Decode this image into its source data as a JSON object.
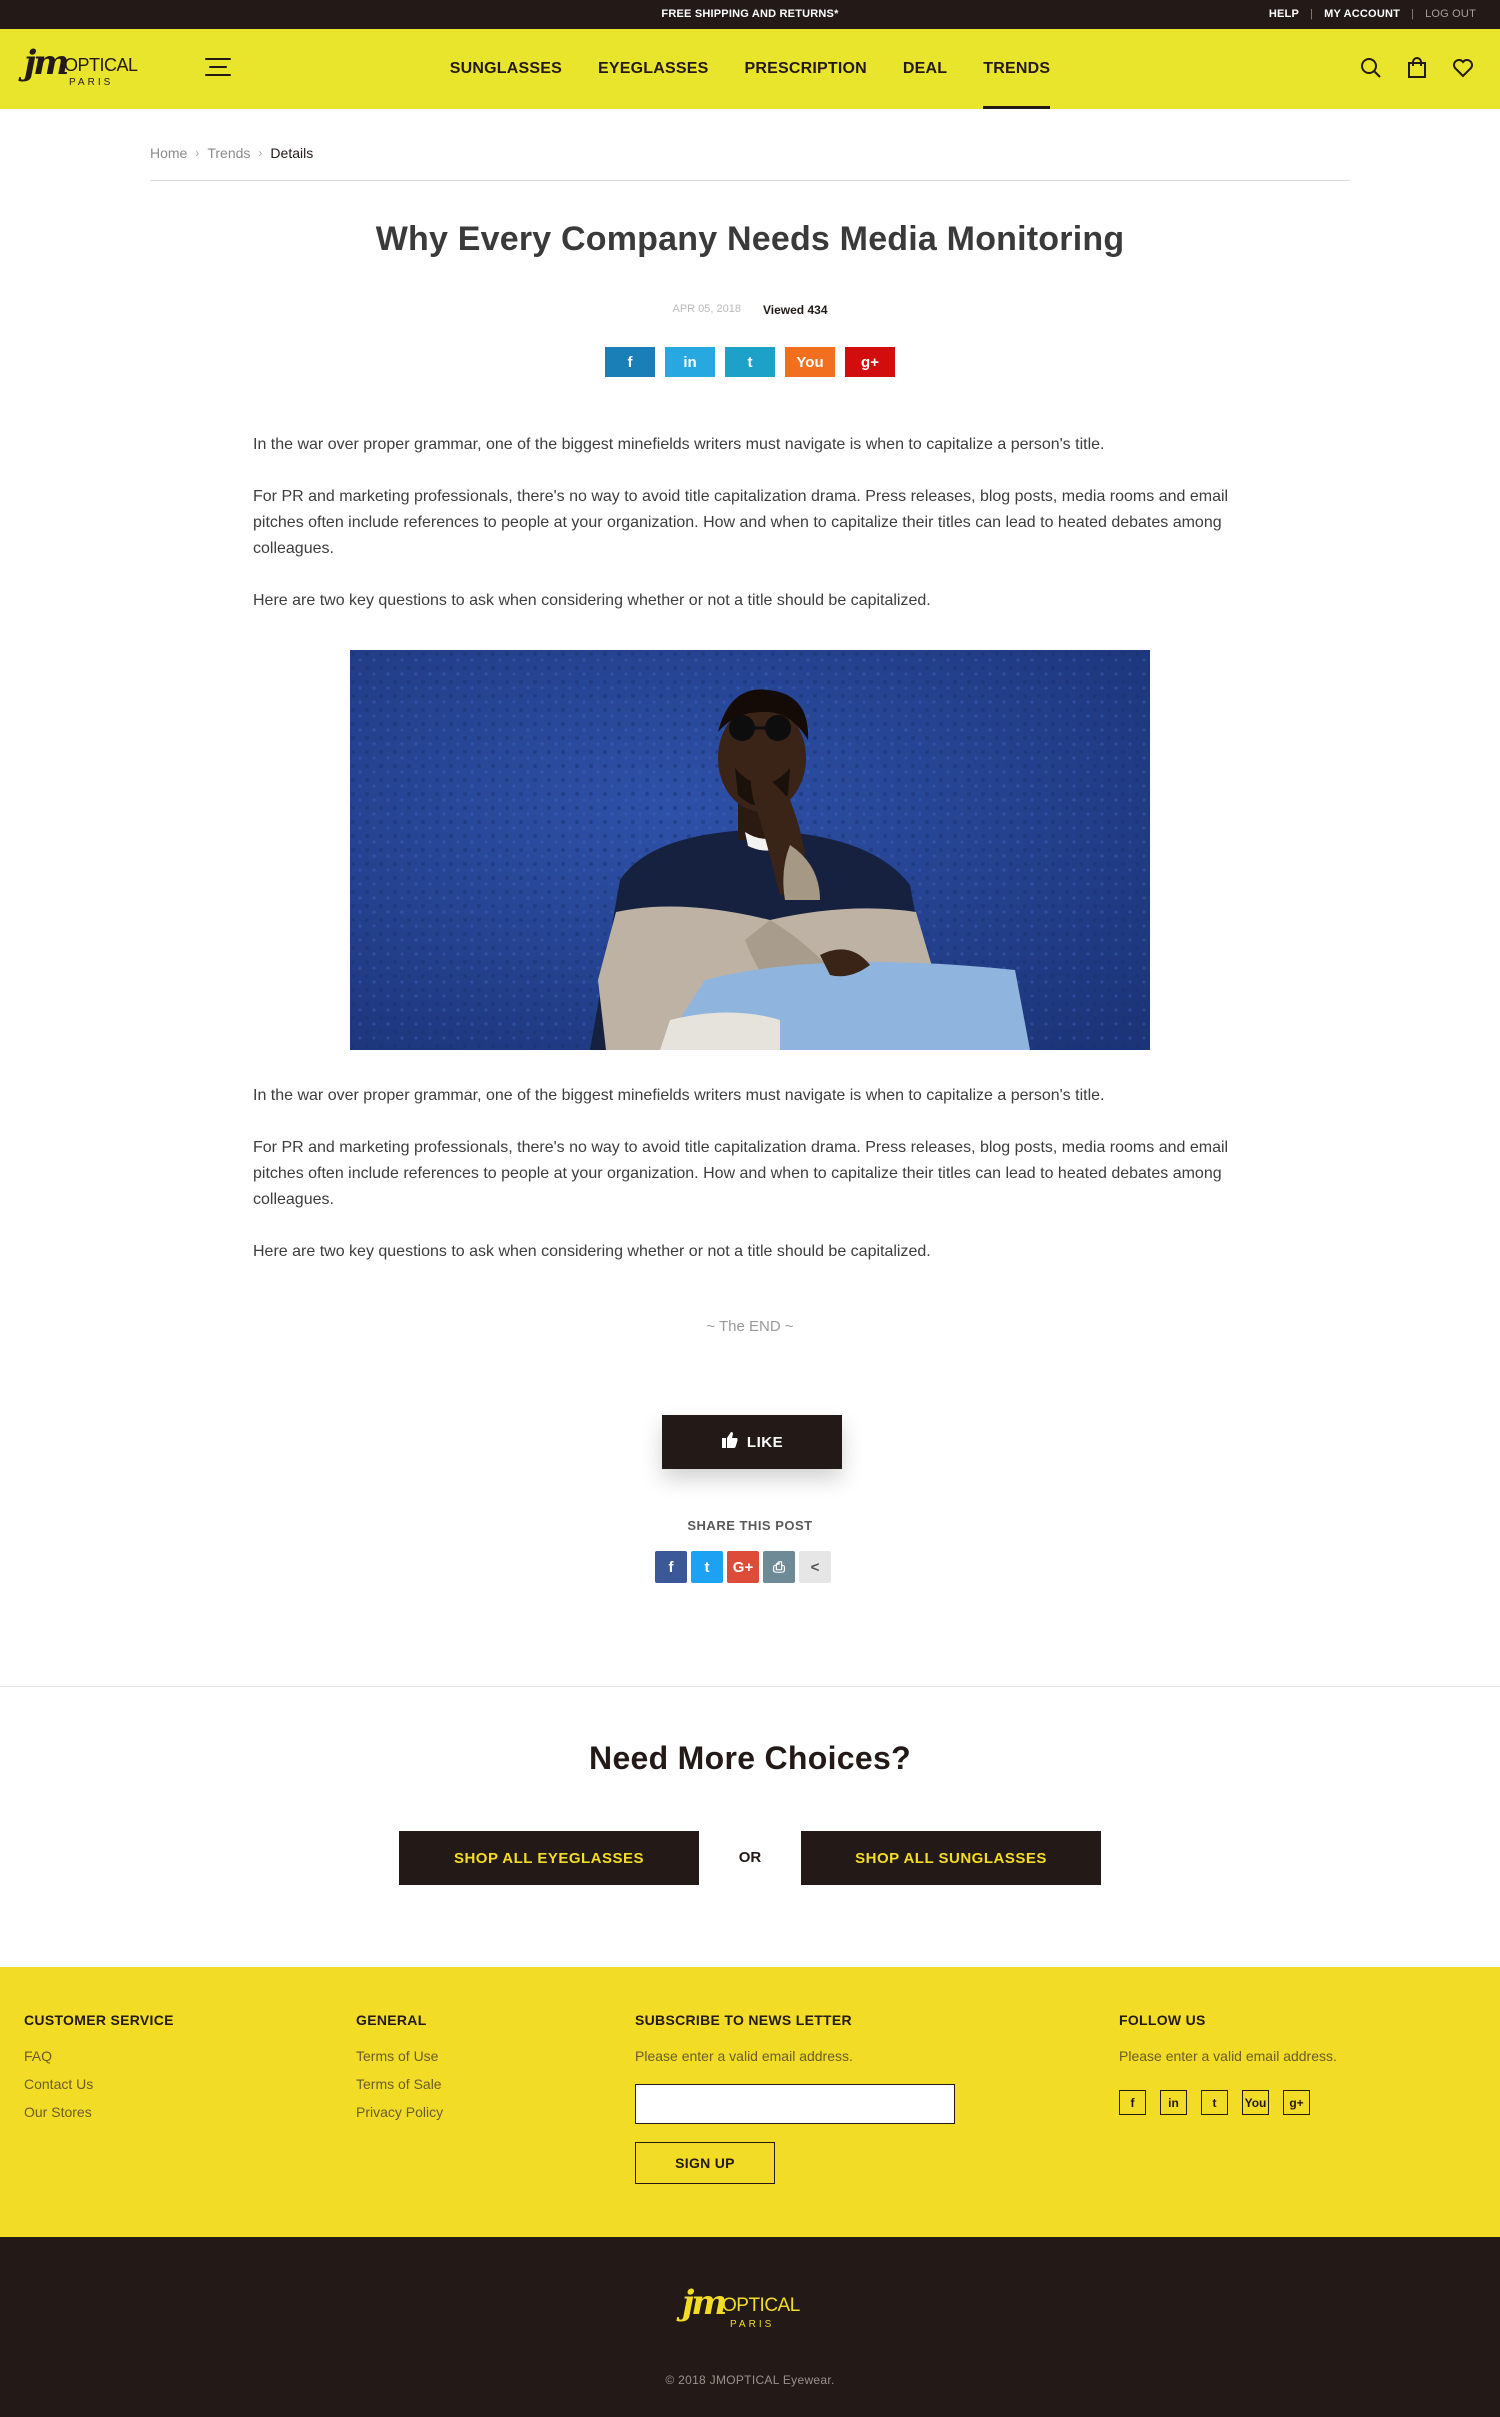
{
  "topbar": {
    "promo": "FREE SHIPPING AND RETURNS*",
    "help": "HELP",
    "account": "MY ACCOUNT",
    "logout": "LOG OUT"
  },
  "brand": {
    "mark": "jm",
    "name": "OPTICAL",
    "city": "PARIS"
  },
  "nav": {
    "items": [
      {
        "label": "SUNGLASSES"
      },
      {
        "label": "EYEGLASSES"
      },
      {
        "label": "PRESCRIPTION"
      },
      {
        "label": "DEAL"
      },
      {
        "label": "TRENDS",
        "active": true
      }
    ]
  },
  "header_icons": [
    "search-icon",
    "bag-icon",
    "heart-icon"
  ],
  "breadcrumb": [
    "Home",
    "Trends",
    "Details"
  ],
  "article": {
    "title": "Why Every Company Needs Media Monitoring",
    "date": "APR 05, 2018",
    "views": "Viewed 434",
    "share_buttons": [
      {
        "icon": "facebook-icon",
        "glyph": "f",
        "color": "#1b7fb7"
      },
      {
        "icon": "linkedin-icon",
        "glyph": "in",
        "color": "#28a8e0"
      },
      {
        "icon": "twitter-icon",
        "glyph": "t",
        "color": "#1ea1c9"
      },
      {
        "icon": "youtube-icon",
        "glyph": "You",
        "color": "#f26f1f"
      },
      {
        "icon": "google-plus-icon",
        "glyph": "g+",
        "color": "#d20d0d"
      }
    ],
    "p1": "In the war over proper grammar, one of the biggest minefields writers must navigate is when to capitalize a person's title.",
    "p2": "For PR and marketing professionals, there's no way to avoid title capitalization drama. Press releases, blog posts, media rooms and email pitches often include references to people at your organization. How and when to capitalize their titles can lead to heated debates among colleagues.",
    "p3": "Here are two key questions to ask when considering whether or not a title should be capitalized.",
    "p4": "In the war over proper grammar, one of the biggest minefields writers must navigate is when to capitalize a person's title.",
    "p5": "For PR and marketing professionals, there's no way to avoid title capitalization drama. Press releases, blog posts, media rooms and email pitches often include references to people at your organization. How and when to capitalize their titles can lead to heated debates among colleagues.",
    "p6": "Here are two key questions to ask when considering whether or not a title should be capitalized.",
    "end": "~ The END ~",
    "like": "LIKE",
    "share_title": "SHARE THIS POST",
    "share_icons": [
      {
        "icon": "facebook-icon",
        "glyph": "f",
        "color": "#3b5998"
      },
      {
        "icon": "twitter-icon",
        "glyph": "t",
        "color": "#1da1f2"
      },
      {
        "icon": "google-plus-icon",
        "glyph": "G+",
        "color": "#dd4b39"
      },
      {
        "icon": "print-icon",
        "glyph": "⎙",
        "color": "#6d8a96"
      },
      {
        "icon": "share-icon",
        "glyph": "<",
        "color": "#e6e6e6"
      }
    ]
  },
  "choices": {
    "title": "Need More Choices?",
    "eyeglasses": "SHOP ALL EYEGLASSES",
    "or": "OR",
    "sunglasses": "SHOP ALL SUNGLASSES"
  },
  "footer": {
    "customer": {
      "title": "CUSTOMER SERVICE",
      "links": [
        "FAQ",
        "Contact Us",
        "Our Stores"
      ]
    },
    "general": {
      "title": "GENERAL",
      "links": [
        "Terms of Use",
        "Terms of Sale",
        "Privacy Policy"
      ]
    },
    "newsletter": {
      "title": "SUBSCRIBE TO NEWS LETTER",
      "note": "Please enter a valid email address.",
      "button": "SIGN UP",
      "email_value": ""
    },
    "follow": {
      "title": "FOLLOW US",
      "note": "Please enter a valid email address.",
      "icons": [
        {
          "icon": "facebook-icon",
          "glyph": "f"
        },
        {
          "icon": "linkedin-icon",
          "glyph": "in"
        },
        {
          "icon": "twitter-icon",
          "glyph": "t"
        },
        {
          "icon": "youtube-icon",
          "glyph": "You"
        },
        {
          "icon": "google-plus-icon",
          "glyph": "g+"
        }
      ]
    }
  },
  "copyright": "© 2018 JMOPTICAL Eyewear.",
  "colors": {
    "yellow": "#e9e52d",
    "footer_yellow": "#f3dc26",
    "dark": "#231a17"
  }
}
